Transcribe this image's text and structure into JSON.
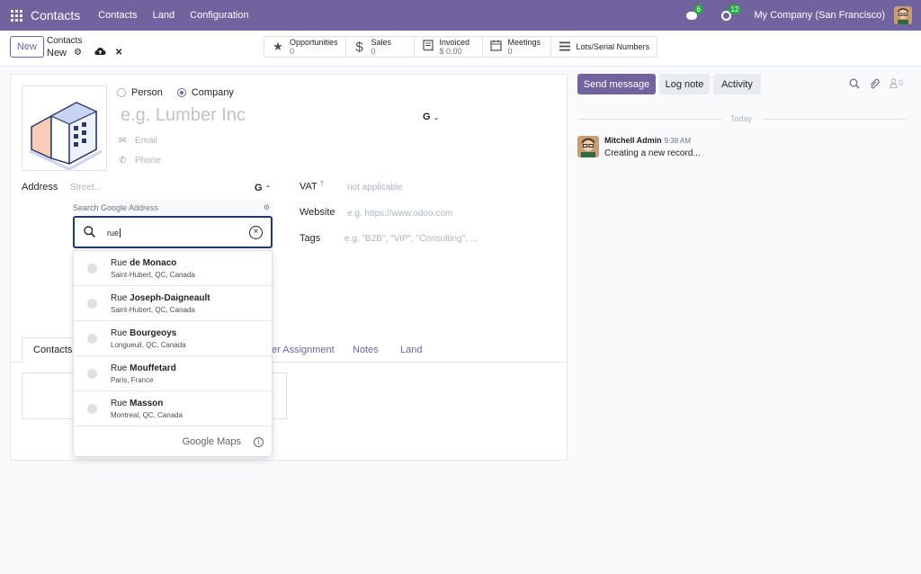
{
  "navbar": {
    "app_name": "Contacts",
    "menu": [
      "Contacts",
      "Land",
      "Configuration"
    ],
    "messages_count": "6",
    "activities_count": "12",
    "company": "My Company (San Francisco)"
  },
  "control": {
    "new_label": "New",
    "breadcrumb_parent": "Contacts",
    "breadcrumb_current": "New",
    "smart_buttons": [
      {
        "label": "Opportunities",
        "value": "0",
        "icon": "star-icon"
      },
      {
        "label": "Sales",
        "value": "0",
        "icon": "dollar-icon"
      },
      {
        "label": "Invoiced",
        "value": "$ 0.00",
        "icon": "invoice-icon"
      },
      {
        "label": "Meetings",
        "value": "0",
        "icon": "calendar-icon"
      },
      {
        "label": "Lots/Serial Numbers",
        "value": "",
        "icon": "list-icon"
      }
    ]
  },
  "form": {
    "type_person": "Person",
    "type_company": "Company",
    "name_placeholder": "e.g. Lumber Inc",
    "email_placeholder": "Email",
    "phone_placeholder": "Phone",
    "address_label": "Address",
    "street_placeholder": "Street...",
    "google_toggle": "G",
    "vat_label": "VAT",
    "vat_help": "?",
    "vat_placeholder": "not applicable",
    "website_label": "Website",
    "website_placeholder": "e.g. https://www.odoo.com",
    "tags_label": "Tags",
    "tags_placeholder": "e.g. \"B2B\", \"VIP\", \"Consulting\", ...",
    "tabs": [
      "Contacts",
      "er Assignment",
      "Notes",
      "Land"
    ]
  },
  "google": {
    "panel_title": "Search Google Address",
    "query": "rue",
    "results": [
      {
        "prefix": "Rue",
        "bold": "de Monaco",
        "sub": "Saint-Hubert, QC, Canada"
      },
      {
        "prefix": "Rue",
        "bold": "Joseph-Daigneault",
        "sub": "Saint-Hubert, QC, Canada"
      },
      {
        "prefix": "Rue",
        "bold": "Bourgeoys",
        "sub": "Longueuil, QC, Canada"
      },
      {
        "prefix": "Rue",
        "bold": "Mouffetard",
        "sub": "Paris, France"
      },
      {
        "prefix": "Rue",
        "bold": "Masson",
        "sub": "Montreal, QC, Canada"
      }
    ],
    "footer": "Google Maps"
  },
  "chatter": {
    "send_label": "Send message",
    "log_label": "Log note",
    "activity_label": "Activity",
    "followers_count": "0",
    "today_label": "Today",
    "author": "Mitchell Admin",
    "time": "9:38 AM",
    "body": "Creating a new record..."
  },
  "colors": {
    "brand": "#71639e",
    "search_border": "#1e3a6e",
    "badge": "#28a745"
  }
}
